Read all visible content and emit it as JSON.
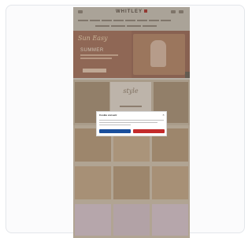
{
  "store": {
    "brand": "WHITLEY"
  },
  "hero": {
    "title": "Sun Easy",
    "subtitle": "SUMMER"
  },
  "promo": {
    "script": "style"
  },
  "consent": {
    "title": "Cookie consent",
    "close": "×",
    "accept": "",
    "decline": ""
  },
  "colors": {
    "brand_accent": "#a8352f",
    "accept_button": "#1a4f9c",
    "decline_button": "#c42b2b"
  }
}
